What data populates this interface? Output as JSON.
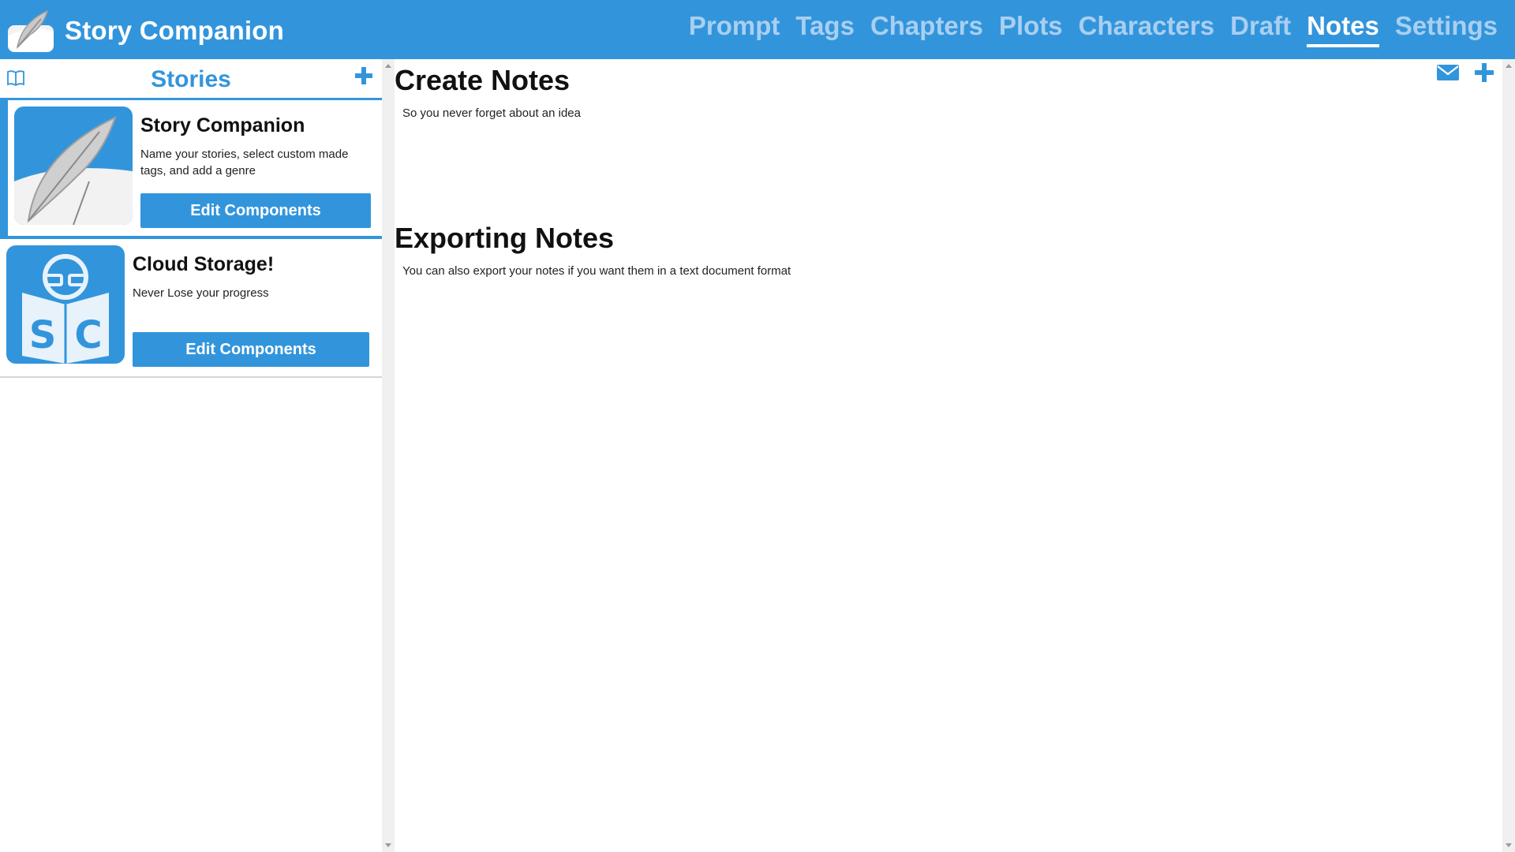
{
  "app": {
    "title": "Story Companion"
  },
  "nav": {
    "items": [
      {
        "label": "Prompt",
        "active": false
      },
      {
        "label": "Tags",
        "active": false
      },
      {
        "label": "Chapters",
        "active": false
      },
      {
        "label": "Plots",
        "active": false
      },
      {
        "label": "Characters",
        "active": false
      },
      {
        "label": "Draft",
        "active": false
      },
      {
        "label": "Notes",
        "active": true
      },
      {
        "label": "Settings",
        "active": false
      }
    ]
  },
  "sidebar": {
    "title": "Stories",
    "book_icon": "book-icon",
    "add_icon": "plus-icon",
    "cards": [
      {
        "title": "Story Companion",
        "description": "Name your stories, select custom made tags, and add a genre",
        "button": "Edit Components",
        "thumbnail": "quill-logo",
        "selected": true
      },
      {
        "title": "Cloud Storage!",
        "description": "Never Lose your progress",
        "button": "Edit Components",
        "thumbnail": "sc-reader-logo",
        "selected": false
      }
    ]
  },
  "main": {
    "sections": [
      {
        "title": "Create Notes",
        "subtitle": "So you never forget about an idea"
      },
      {
        "title": "Exporting Notes",
        "subtitle": "You can also export your notes if you want them in a text document format"
      }
    ],
    "toolbar": {
      "mail_icon": "envelope-icon",
      "add_icon": "plus-icon"
    }
  },
  "colors": {
    "accent": "#3295dc",
    "nav_inactive": "#a9cff0",
    "nav_active": "#ffffff"
  }
}
